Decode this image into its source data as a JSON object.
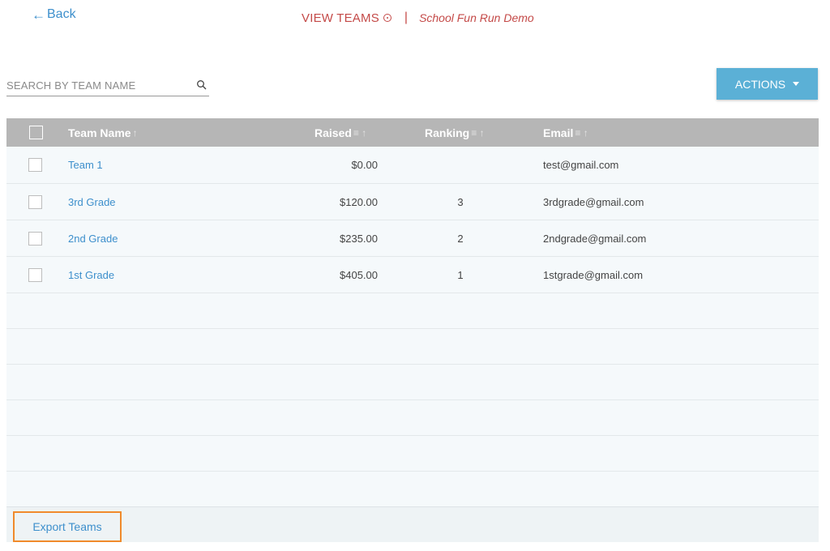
{
  "header": {
    "back_label": "Back",
    "title": "VIEW TEAMS",
    "separator": "|",
    "event_name": "School Fun Run Demo"
  },
  "search": {
    "placeholder": "SEARCH BY TEAM NAME",
    "value": ""
  },
  "actions": {
    "label": "ACTIONS"
  },
  "table": {
    "columns": {
      "team_name": "Team Name",
      "raised": "Raised",
      "ranking": "Ranking",
      "email": "Email"
    },
    "rows": [
      {
        "team": "Team 1",
        "raised": "$0.00",
        "ranking": "",
        "email": "test@gmail.com"
      },
      {
        "team": "3rd Grade",
        "raised": "$120.00",
        "ranking": "3",
        "email": "3rdgrade@gmail.com"
      },
      {
        "team": "2nd Grade",
        "raised": "$235.00",
        "ranking": "2",
        "email": "2ndgrade@gmail.com"
      },
      {
        "team": "1st Grade",
        "raised": "$405.00",
        "ranking": "1",
        "email": "1stgrade@gmail.com"
      }
    ]
  },
  "footer": {
    "export_label": "Export Teams"
  },
  "colors": {
    "accent": "#3d8fcc",
    "title": "#c44a48",
    "actions_button": "#5bb0d6",
    "header_bg": "#b6b6b6",
    "highlight_border": "#f08a2b"
  }
}
